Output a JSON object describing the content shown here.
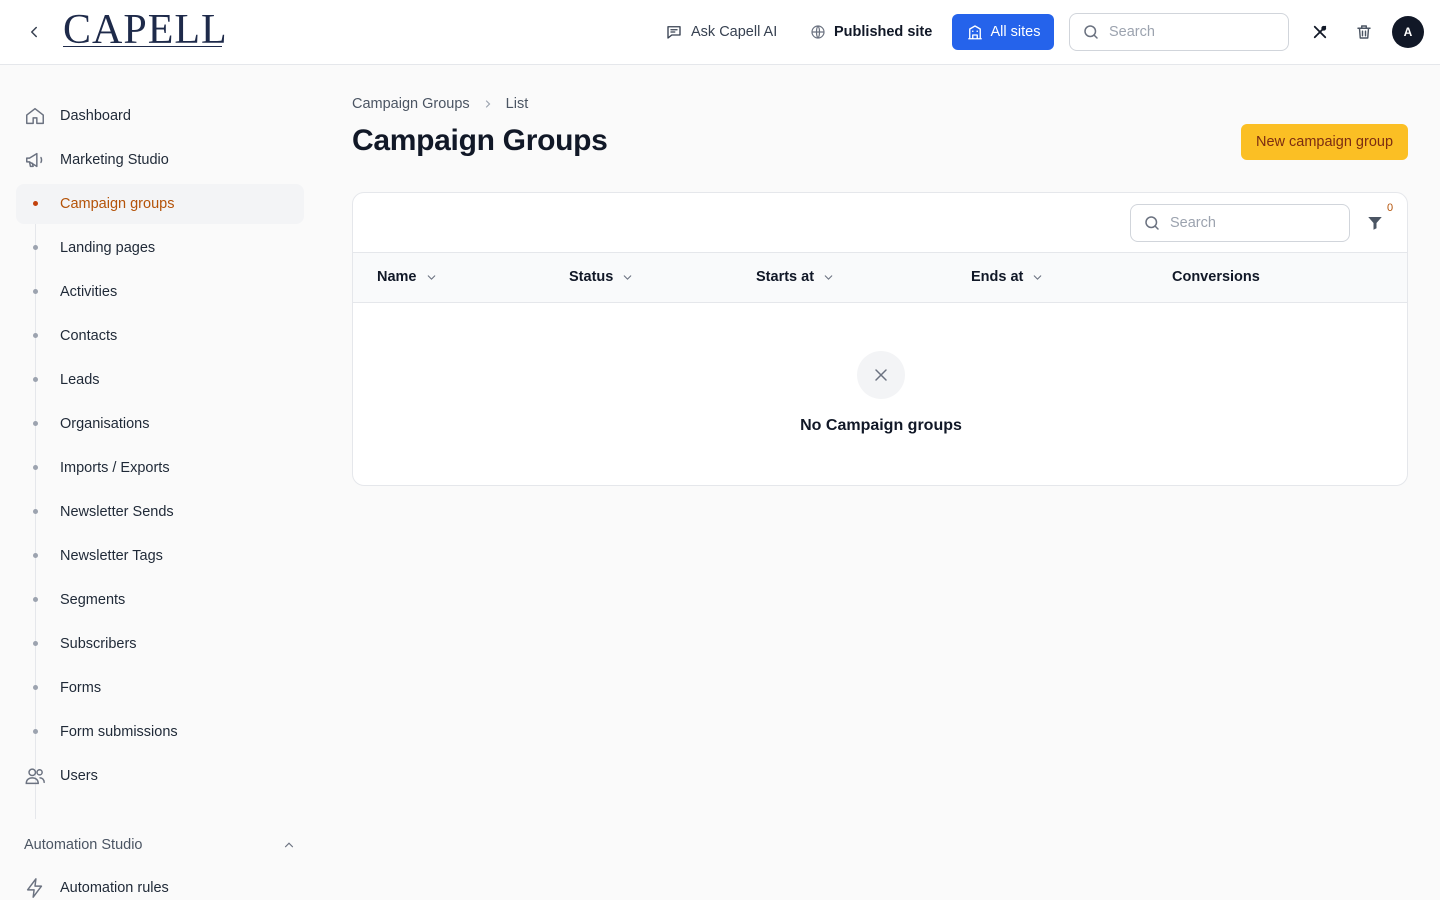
{
  "header": {
    "logo_text": "CAPELL",
    "ask_ai_label": "Ask Capell AI",
    "published_site_label": "Published site",
    "all_sites_label": "All sites",
    "search_placeholder": "Search",
    "avatar_initial": "A"
  },
  "sidebar": {
    "items": [
      {
        "label": "Dashboard",
        "icon": "home-icon"
      },
      {
        "label": "Marketing Studio",
        "icon": "megaphone-icon"
      },
      {
        "label": "Campaign groups",
        "active": true
      },
      {
        "label": "Landing pages"
      },
      {
        "label": "Activities"
      },
      {
        "label": "Contacts"
      },
      {
        "label": "Leads"
      },
      {
        "label": "Organisations"
      },
      {
        "label": "Imports / Exports"
      },
      {
        "label": "Newsletter Sends"
      },
      {
        "label": "Newsletter Tags"
      },
      {
        "label": "Segments"
      },
      {
        "label": "Subscribers"
      },
      {
        "label": "Forms"
      },
      {
        "label": "Form submissions"
      },
      {
        "label": "Users",
        "icon": "users-icon"
      }
    ],
    "section": {
      "label": "Automation Studio",
      "expanded": true
    },
    "automation_items": [
      {
        "label": "Automation rules",
        "icon": "bolt-icon"
      }
    ]
  },
  "breadcrumb": {
    "parent": "Campaign Groups",
    "current": "List"
  },
  "page": {
    "title": "Campaign Groups",
    "new_button_label": "New campaign group"
  },
  "table": {
    "search_placeholder": "Search",
    "filter_count": "0",
    "columns": [
      "Name",
      "Status",
      "Starts at",
      "Ends at",
      "Conversions"
    ],
    "empty_message": "No Campaign groups"
  },
  "colors": {
    "accent": "#2563eb",
    "primary_button": "#fbbf24",
    "active_nav_text": "#b45309"
  }
}
